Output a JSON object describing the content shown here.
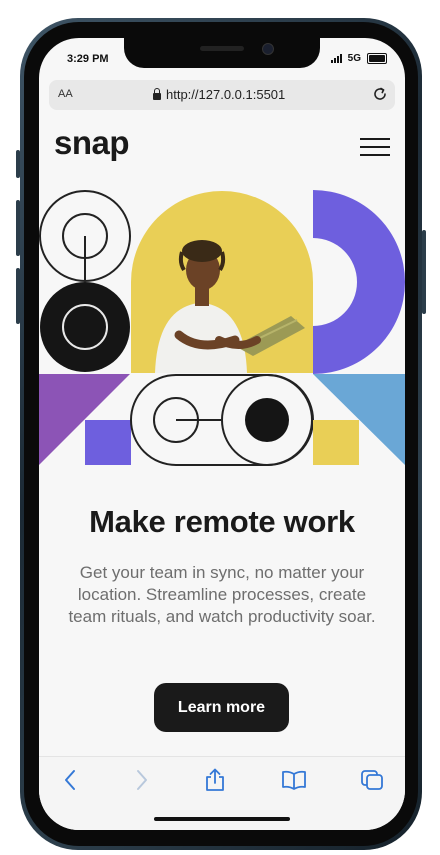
{
  "status_bar": {
    "time": "3:29 PM",
    "network": "5G"
  },
  "browser": {
    "text_size_label": "AA",
    "url": "http://127.0.0.1:5501"
  },
  "site": {
    "logo": "snap",
    "headline": "Make remote work",
    "description": "Get your team in sync, no matter your location. Streamline processes, create team rituals, and watch productivity soar.",
    "cta_label": "Learn more"
  },
  "colors": {
    "yellow": "#e9cf56",
    "purple": "#7b5fd9",
    "blue": "#6aa7d6",
    "violet": "#8c54b6",
    "dark": "#1a1a1a"
  },
  "icons": [
    "lock-icon",
    "reload-icon",
    "menu-icon",
    "back-icon",
    "forward-icon",
    "share-icon",
    "bookmarks-icon",
    "tabs-icon"
  ]
}
